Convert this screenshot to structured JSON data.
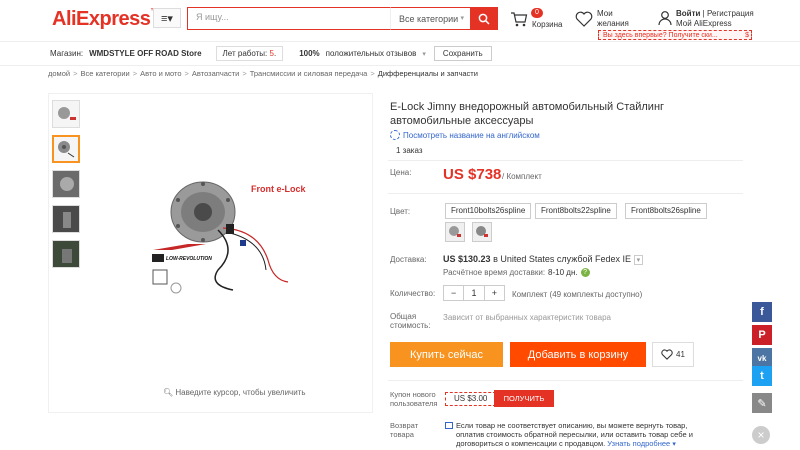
{
  "header": {
    "logo": "AliExpress",
    "search_placeholder": "Я ищу...",
    "search_category": "Все категории",
    "cart_badge": "0",
    "cart_label": "Корзина",
    "wish_label_1": "Мои",
    "wish_label_2": "желания",
    "login": "Войти",
    "register": "Регистрация",
    "my_account": "Мой AliExpress",
    "promo": "Вы здесь впервые? Получите ски...",
    "promo_dollar": "$",
    "accent": "#e43225"
  },
  "store": {
    "label": "Магазин:",
    "name": "WMDSTYLE OFF ROAD Store",
    "years_label": "Лет работы:",
    "years_value": "5",
    "years_suffix": ".",
    "pct": "100%",
    "reviews": "положительных отзывов",
    "save": "Сохранить"
  },
  "breadcrumbs": [
    "домой",
    "Все категории",
    "Авто и мото",
    "Автозапчасти",
    "Трансмиссии и силовая передача",
    "Дифференциалы и запчасти"
  ],
  "gallery": {
    "zoom_hint": "Наведите курсор, чтобы увеличить",
    "image_caption": "Front e-Lock"
  },
  "product": {
    "title": "E-Lock Jimny внедорожный автомобильный Стайлинг автомобильные аксессуары",
    "translate": "Посмотреть название на английском",
    "orders": "1 заказ",
    "price_label": "Цена:",
    "price": "US $738",
    "price_unit": "/ Комплект",
    "color_label": "Цвет:",
    "variants": [
      "Front10bolts26spline",
      "Front8bolts22spline",
      "Front8bolts26spline"
    ],
    "shipping_label": "Доставка:",
    "shipping_price": "US $130.23",
    "shipping_via": "в United States службой Fedex IE",
    "shipping_est_label": "Расчётное время доставки:",
    "shipping_est_days": "8-10 дн.",
    "qty_label": "Количество:",
    "qty_minus": "−",
    "qty_value": "1",
    "qty_plus": "+",
    "qty_info": "Комплект (49 комплекты доступно)",
    "total_label_1": "Общая",
    "total_label_2": "стоимость:",
    "total_value": "Зависит от выбранных характеристик товара",
    "buy_now": "Купить сейчас",
    "add_to_cart": "Добавить в корзину",
    "wish_count": "41",
    "coupon_label_1": "Купон нового",
    "coupon_label_2": "пользователя",
    "coupon_value": "US $3.00",
    "coupon_btn": "ПОЛУЧИТЬ",
    "return_label_1": "Возврат",
    "return_label_2": "товара",
    "return_line1": "Если товар не соответствует описанию, вы можете вернуть товар,",
    "return_line2": "оплатив стоимость обратной пересылки, или оставить товар себе и",
    "return_line3": "договориться о компенсации с продавцом.",
    "return_link": "Узнать подробнее"
  },
  "social": [
    "facebook-icon",
    "pinterest-icon",
    "vk-icon",
    "twitter-icon",
    "edit-icon"
  ]
}
